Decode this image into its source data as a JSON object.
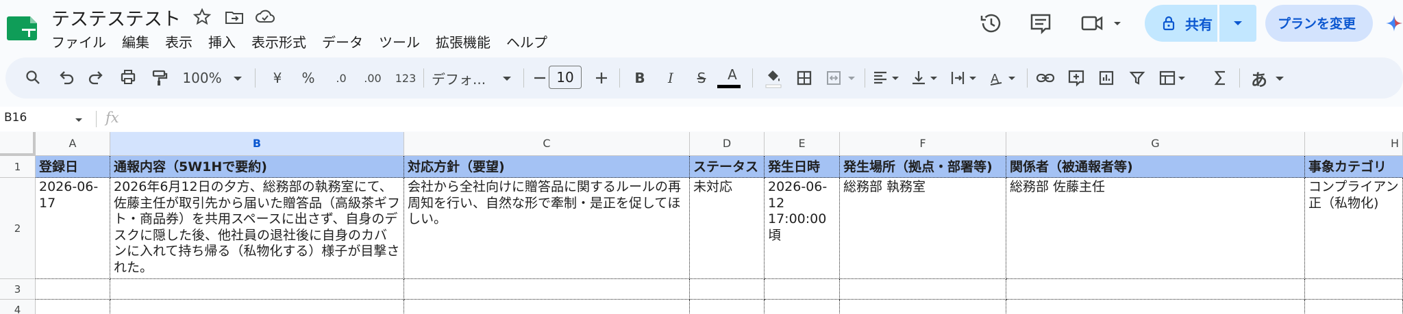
{
  "app": {
    "doc_title": "テステステスト",
    "menu": [
      "ファイル",
      "編集",
      "表示",
      "挿入",
      "表示形式",
      "データ",
      "ツール",
      "拡張機能",
      "ヘルプ"
    ],
    "share_label": "共有",
    "plan_label": "プランを変更"
  },
  "toolbar": {
    "zoom": "100%",
    "currency": "¥",
    "percent": "%",
    "decimal_decrease": ".0",
    "decimal_increase": ".00",
    "number_format": "123",
    "font": "デフォ...",
    "font_size": "10",
    "bold": "B",
    "italic": "I",
    "strike": "S",
    "text_color": "A",
    "input_tools": "あ"
  },
  "formula_bar": {
    "cell_ref": "B16",
    "fx": "fx"
  },
  "sheet": {
    "columns": [
      "A",
      "B",
      "C",
      "D",
      "E",
      "F",
      "G",
      "H"
    ],
    "selected_column": "B",
    "rows": [
      "1",
      "2",
      "3",
      "4"
    ],
    "header": [
      "登録日",
      "通報内容（5W1Hで要約)",
      "対応方針（要望)",
      "ステータス",
      "発生日時",
      "発生場所（拠点・部署等)",
      "関係者（被通報者等)",
      "事象カテゴリ"
    ],
    "row2": [
      "2026-06-17",
      "2026年6月12日の夕方、総務部の執務室にて、佐藤主任が取引先から届いた贈答品（高級茶ギフト・商品券）を共用スペースに出さず、自身のデスクに隠した後、他社員の退社後に自身のカバンに入れて持ち帰る（私物化する）様子が目撃された。",
      "会社から全社向けに贈答品に関するルールの再周知を行い、自然な形で牽制・是正を促してほしい。",
      "未対応",
      "2026-06-12 17:00:00頃",
      "総務部 執務室",
      "総務部 佐藤主任",
      "コンプライアン正（私物化)"
    ]
  },
  "colors": {
    "header_fill": "#a4c2f4",
    "share_fill": "#c2e7ff",
    "plan_fill": "#d3e3fd",
    "accent": "#0b57d0",
    "logo_green": "#0f9d58"
  }
}
